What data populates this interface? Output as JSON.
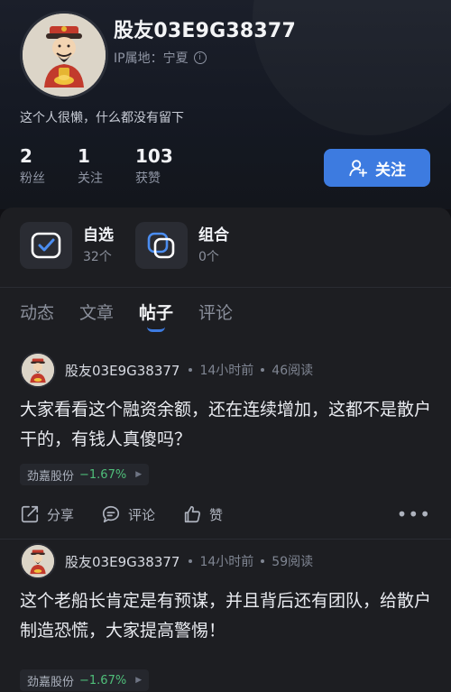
{
  "profile": {
    "username": "股友03E9G38377",
    "ip_label": "IP属地：宁夏",
    "bio": "这个人很懒，什么都没有留下",
    "stats": [
      {
        "value": "2",
        "label": "粉丝"
      },
      {
        "value": "1",
        "label": "关注"
      },
      {
        "value": "103",
        "label": "获赞"
      }
    ],
    "follow_label": "关注"
  },
  "quick_links": [
    {
      "title": "自选",
      "sub": "32个"
    },
    {
      "title": "组合",
      "sub": "0个"
    }
  ],
  "tabs": [
    {
      "label": "动态",
      "active": false
    },
    {
      "label": "文章",
      "active": false
    },
    {
      "label": "帖子",
      "active": true
    },
    {
      "label": "评论",
      "active": false
    }
  ],
  "posts": [
    {
      "author": "股友03E9G38377",
      "time": "14小时前",
      "reads": "46阅读",
      "text": "大家看看这个融资余额，还在连续增加，这都不是散户干的，有钱人真傻吗？",
      "stock_name": "劲嘉股份",
      "stock_change": "−1.67%",
      "actions": {
        "share": "分享",
        "comment": "评论",
        "like": "赞"
      }
    },
    {
      "author": "股友03E9G38377",
      "time": "14小时前",
      "reads": "59阅读",
      "text": "这个老船长肯定是有预谋，并且背后还有团队，给散户制造恐慌，大家提高警惕！",
      "stock_name": "劲嘉股份",
      "stock_change": "−1.67%"
    }
  ],
  "colors": {
    "accent": "#3d7be0",
    "down_green": "#4fbf7a",
    "panel_bg": "#1d1e22"
  }
}
